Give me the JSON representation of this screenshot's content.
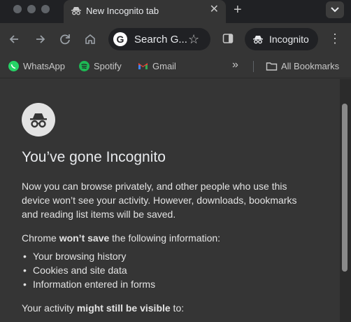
{
  "window": {
    "tab_title": "New Incognito tab"
  },
  "toolbar": {
    "omnibox_text": "Search G...",
    "incognito_label": "Incognito"
  },
  "bookmarks": {
    "items": [
      {
        "label": "WhatsApp",
        "icon": "whatsapp-icon",
        "color": "#25d366"
      },
      {
        "label": "Spotify",
        "icon": "spotify-icon",
        "color": "#1db954"
      },
      {
        "label": "Gmail",
        "icon": "gmail-icon",
        "color": "#ea4335"
      }
    ],
    "all_bookmarks_label": "All Bookmarks"
  },
  "page": {
    "heading": "You’ve gone Incognito",
    "intro": "Now you can browse privately, and other people who use this device won’t see your activity. However, downloads, bookmarks and reading list items will be saved.",
    "wont_save_prefix": "Chrome ",
    "wont_save_bold": "won’t save",
    "wont_save_suffix": " the following information:",
    "not_saved_items": [
      "Your browsing history",
      "Cookies and site data",
      "Information entered in forms"
    ],
    "visible_prefix": "Your activity ",
    "visible_bold": "might still be visible",
    "visible_suffix": " to:"
  }
}
